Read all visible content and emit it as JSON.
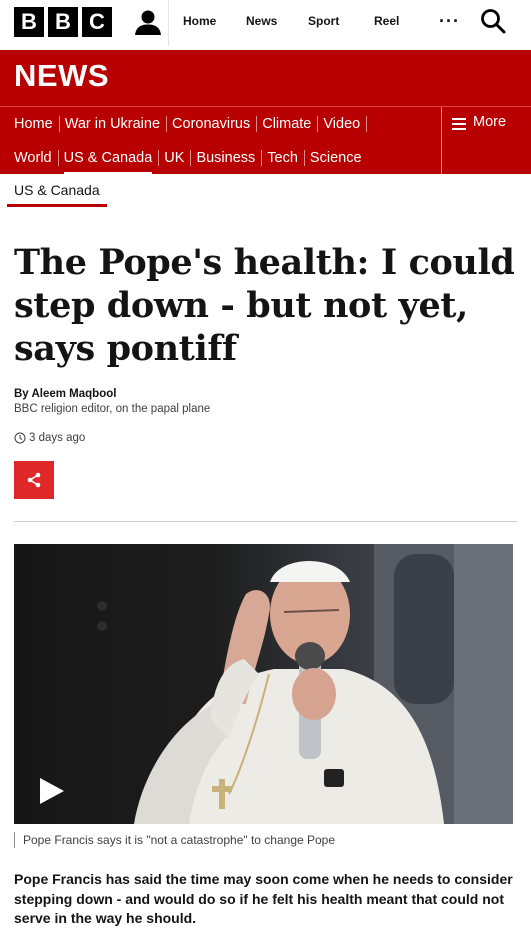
{
  "header": {
    "logo_letters": [
      "B",
      "B",
      "C"
    ],
    "links": [
      "Home",
      "News",
      "Sport",
      "Reel"
    ],
    "more_label": "···"
  },
  "banner": {
    "title": "NEWS"
  },
  "nav": {
    "row1": [
      "Home",
      "War in Ukraine",
      "Coronavirus",
      "Climate",
      "Video"
    ],
    "row2": [
      "World",
      "US & Canada",
      "UK",
      "Business",
      "Tech",
      "Science"
    ],
    "active": "US & Canada",
    "more_label": "More"
  },
  "article": {
    "section": "US & Canada",
    "headline": "The Pope's health: I could step down - but not yet, says pontiff",
    "byline_name": "By Aleem Maqbool",
    "byline_role": "BBC religion editor, on the papal plane",
    "timestamp": "3 days ago",
    "caption": "Pope Francis says it is \"not a catastrophe\" to change Pope",
    "lede": "Pope Francis has said the time may soon come when he needs to consider stepping down - and would do so if he felt his health meant that could not serve in the way he should."
  },
  "colors": {
    "brand_red": "#b80000",
    "share_red": "#e0282a"
  },
  "icons": [
    "account-icon",
    "search-icon",
    "menu-icon",
    "clock-icon",
    "share-icon",
    "play-icon"
  ]
}
